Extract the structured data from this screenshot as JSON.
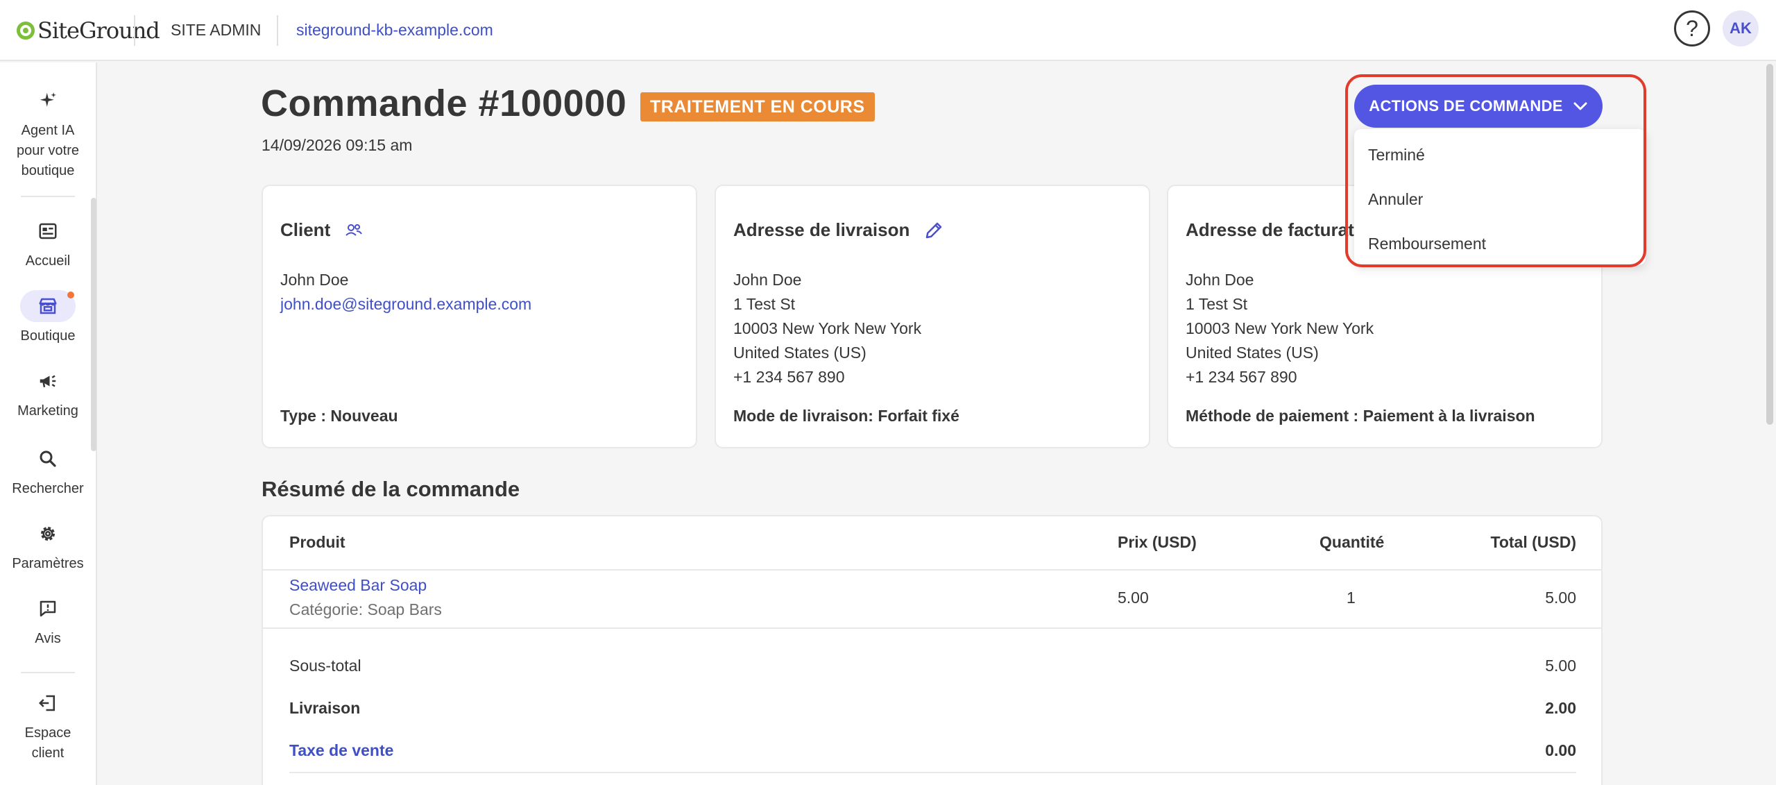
{
  "header": {
    "logo_text": "SiteGround",
    "site_admin": "SITE ADMIN",
    "site_url": "siteground-kb-example.com",
    "help_label": "?",
    "avatar_initials": "AK"
  },
  "sidebar": {
    "items": [
      {
        "label": "Agent IA pour votre boutique",
        "icon": "sparkle-icon"
      },
      {
        "label": "Accueil",
        "icon": "dashboard-icon"
      },
      {
        "label": "Boutique",
        "icon": "store-icon"
      },
      {
        "label": "Marketing",
        "icon": "megaphone-icon"
      },
      {
        "label": "Rechercher",
        "icon": "search-icon"
      },
      {
        "label": "Paramètres",
        "icon": "gear-icon"
      },
      {
        "label": "Avis",
        "icon": "feedback-icon"
      },
      {
        "label": "Espace client",
        "icon": "exit-icon"
      }
    ]
  },
  "order": {
    "title": "Commande #100000",
    "status": "TRAITEMENT EN COURS",
    "date": "14/09/2026 09:15 am",
    "actions_label": "ACTIONS DE COMMANDE",
    "actions_menu": [
      "Terminé",
      "Annuler",
      "Remboursement"
    ]
  },
  "client_card": {
    "title": "Client",
    "name": "John Doe",
    "email": "john.doe@siteground.example.com",
    "footer": "Type : Nouveau"
  },
  "shipping_card": {
    "title": "Adresse de livraison",
    "lines": [
      "John Doe",
      "1 Test St",
      "10003 New York New York",
      "United States (US)",
      "+1 234 567 890"
    ],
    "footer": "Mode de livraison: Forfait fixé"
  },
  "billing_card": {
    "title": "Adresse de facturat",
    "lines": [
      "John Doe",
      "1 Test St",
      "10003 New York New York",
      "United States (US)",
      "+1 234 567 890"
    ],
    "footer": "Méthode de paiement : Paiement à la livraison"
  },
  "summary": {
    "title": "Résumé de la commande",
    "columns": [
      "Produit",
      "Prix (USD)",
      "Quantité",
      "Total (USD)"
    ],
    "rows": [
      {
        "product": "Seaweed Bar Soap",
        "category": "Catégorie: Soap Bars",
        "price": "5.00",
        "qty": "1",
        "total": "5.00"
      }
    ],
    "totals": [
      {
        "label": "Sous-total",
        "value": "5.00"
      },
      {
        "label": "Livraison",
        "value": "2.00"
      },
      {
        "label": "Taxe de vente",
        "value": "0.00"
      }
    ]
  },
  "colors": {
    "primary": "#5256e3",
    "link": "#3f4fc5",
    "status": "#ea8a34",
    "highlight": "#e23b2e",
    "notification": "#f0763b"
  }
}
